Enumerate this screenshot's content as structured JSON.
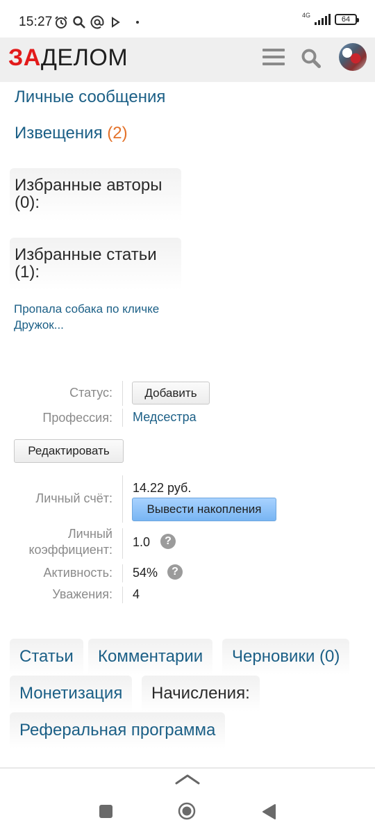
{
  "status_bar": {
    "time": "15:27",
    "network": "4G",
    "battery": "64",
    "icons": [
      "alarm-icon",
      "search-icon",
      "at-icon",
      "play-icon",
      "dot-icon"
    ]
  },
  "header": {
    "logo_red": "ЗА",
    "logo_dark": "ДЕЛОМ",
    "logo_red_color": "#e21b1b"
  },
  "links": {
    "messages": "Личные сообщения",
    "notifications": "Извещения",
    "notifications_count": "(2)"
  },
  "favorites": {
    "authors": "Избранные авторы (0):",
    "articles": "Избранные статьи (1):",
    "article_items": [
      "Пропала собака по кличке Дружок..."
    ]
  },
  "profile": {
    "status_label": "Статус:",
    "status_button": "Добавить",
    "profession_label": "Профессия:",
    "profession_value": "Медсестра",
    "edit_button": "Редактировать",
    "account_label": "Личный счёт:",
    "account_value": "14.22 руб.",
    "withdraw_button": "Вывести накопления",
    "coef_label": "Личный коэффициент:",
    "coef_value": "1.0",
    "activity_label": "Активность:",
    "activity_value": "54%",
    "respect_label": "Уважения:",
    "respect_value": "4"
  },
  "tabs": [
    {
      "label": "Статьи"
    },
    {
      "label": "Комментарии"
    },
    {
      "label": "Черновики (0)"
    },
    {
      "label": "Монетизация"
    },
    {
      "label": "Начисления:"
    },
    {
      "label": "Реферальная программа"
    }
  ],
  "colors": {
    "link": "#1b5f86",
    "accent_orange": "#e4722a",
    "button_blue": "#8cc3fb"
  }
}
